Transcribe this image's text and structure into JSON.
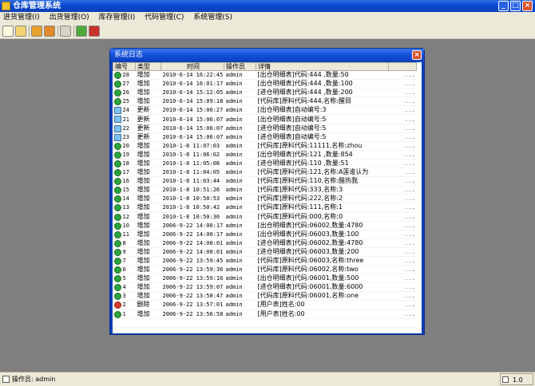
{
  "window": {
    "title": "仓库管理系统",
    "minimize": "_",
    "maximize": "□",
    "close": "×"
  },
  "menu": [
    "进货管理(I)",
    "出货管理(O)",
    "库存管理(I)",
    "代码管理(C)",
    "系统管理(S)"
  ],
  "dialog": {
    "title": "系统日志",
    "close": "×",
    "columns": [
      "编号",
      "类型",
      "时间",
      "操作员",
      "详情"
    ],
    "rows": [
      {
        "icon": "check-icon",
        "id": "28",
        "type": "增加",
        "time": "2010-6-14 16:22:45",
        "op": "admin",
        "detail": "[出仓明细表]代码:444 ,数量:50"
      },
      {
        "icon": "check-icon",
        "id": "27",
        "type": "增加",
        "time": "2010-6-14 16:01:17",
        "op": "admin",
        "detail": "[出仓明细表]代码:444 ,数量:100"
      },
      {
        "icon": "check-icon",
        "id": "26",
        "type": "增加",
        "time": "2010-6-14 15:12:05",
        "op": "admin",
        "detail": "[进仓明细表]代码:444 ,数量:200"
      },
      {
        "icon": "check-icon",
        "id": "25",
        "type": "增加",
        "time": "2010-6-14 15:09:18",
        "op": "admin",
        "detail": "[代码库]原料代码:444,名称:醒目"
      },
      {
        "icon": "edit-icon",
        "id": "24",
        "type": "更新",
        "time": "2010-6-14 15:06:27",
        "op": "admin",
        "detail": "[出仓明细表]自动编号:3"
      },
      {
        "icon": "edit-icon",
        "id": "21",
        "type": "更新",
        "time": "2010-6-14 15:06:07",
        "op": "admin",
        "detail": "[出仓明细表]自动编号:5"
      },
      {
        "icon": "edit-icon",
        "id": "22",
        "type": "更新",
        "time": "2010-6-14 15:06:07",
        "op": "admin",
        "detail": "[进仓明细表]自动编号:5"
      },
      {
        "icon": "edit-icon",
        "id": "23",
        "type": "更新",
        "time": "2010-6-14 15:06:07",
        "op": "admin",
        "detail": "[进仓明细表]自动编号:5"
      },
      {
        "icon": "check-icon",
        "id": "20",
        "type": "增加",
        "time": "2010-1-8 11:07:03",
        "op": "admin",
        "detail": "[代码库]原料代码:11111,名称:zhou"
      },
      {
        "icon": "check-icon",
        "id": "19",
        "type": "增加",
        "time": "2010-1-8 11:06:02",
        "op": "admin",
        "detail": "[出仓明细表]代码:121 ,数量:854"
      },
      {
        "icon": "check-icon",
        "id": "18",
        "type": "增加",
        "time": "2010-1-8 11:05:08",
        "op": "admin",
        "detail": "[进仓明细表]代码:110 ,数量:51"
      },
      {
        "icon": "check-icon",
        "id": "17",
        "type": "增加",
        "time": "2010-1-8 11:04:05",
        "op": "admin",
        "detail": "[代码库]原料代码:121,名称:A莲谁认为"
      },
      {
        "icon": "check-icon",
        "id": "16",
        "type": "增加",
        "time": "2010-1-8 11:03:44",
        "op": "admin",
        "detail": "[代码库]原料代码:110,名称:醋热我"
      },
      {
        "icon": "check-icon",
        "id": "15",
        "type": "增加",
        "time": "2010-1-8 10:51:26",
        "op": "admin",
        "detail": "[代码库]原料代码:333,名称:3"
      },
      {
        "icon": "check-icon",
        "id": "14",
        "type": "增加",
        "time": "2010-1-8 10:50:53",
        "op": "admin",
        "detail": "[代码库]原料代码:222,名称:2"
      },
      {
        "icon": "check-icon",
        "id": "13",
        "type": "增加",
        "time": "2010-1-8 10:50:42",
        "op": "admin",
        "detail": "[代码库]原料代码:111,名称:1"
      },
      {
        "icon": "check-icon",
        "id": "12",
        "type": "增加",
        "time": "2010-1-8 10:50:30",
        "op": "admin",
        "detail": "[代码库]原料代码:000,名称:0"
      },
      {
        "icon": "check-icon",
        "id": "10",
        "type": "增加",
        "time": "2006-9-22 14:00:17",
        "op": "admin",
        "detail": "[出仓明细表]代码:06002,数量:4780"
      },
      {
        "icon": "check-icon",
        "id": "11",
        "type": "增加",
        "time": "2006-9-22 14:00:17",
        "op": "admin",
        "detail": "[出仓明细表]代码:06003,数量:100"
      },
      {
        "icon": "check-icon",
        "id": "8",
        "type": "增加",
        "time": "2006-9-22 14:00:01",
        "op": "admin",
        "detail": "[进仓明细表]代码:06002,数量:4780"
      },
      {
        "icon": "check-icon",
        "id": "9",
        "type": "增加",
        "time": "2006-9-22 14:00:01",
        "op": "admin",
        "detail": "[进仓明细表]代码:06003,数量:200"
      },
      {
        "icon": "check-icon",
        "id": "7",
        "type": "增加",
        "time": "2006-9-22 13:59:45",
        "op": "admin",
        "detail": "[代码库]原料代码:06003,名称:three"
      },
      {
        "icon": "check-icon",
        "id": "6",
        "type": "增加",
        "time": "2006-9-22 13:59:36",
        "op": "admin",
        "detail": "[代码库]原料代码:06002,名称:two"
      },
      {
        "icon": "check-icon",
        "id": "5",
        "type": "增加",
        "time": "2006-9-22 13:59:16",
        "op": "admin",
        "detail": "[出仓明细表]代码:06001,数量:500"
      },
      {
        "icon": "check-icon",
        "id": "4",
        "type": "增加",
        "time": "2006-9-22 13:59:07",
        "op": "admin",
        "detail": "[进仓明细表]代码:06001,数量:6000"
      },
      {
        "icon": "check-icon",
        "id": "3",
        "type": "增加",
        "time": "2006-9-22 13:58:47",
        "op": "admin",
        "detail": "[代码库]原料代码:06001,名称:one"
      },
      {
        "icon": "delete-icon",
        "id": "2",
        "type": "删除",
        "time": "2006-9-22 13:57:01",
        "op": "admin",
        "detail": "[用户表]姓名:00"
      },
      {
        "icon": "check-icon",
        "id": "1",
        "type": "增加",
        "time": "2006-9-22 13:56:58",
        "op": "admin",
        "detail": "[用户表]姓名:00"
      }
    ],
    "more": "..."
  },
  "toolbar": [
    "new-icon",
    "open-icon",
    "edit-icon",
    "settings-icon",
    "search-icon",
    "refresh-icon",
    "exit-icon"
  ],
  "status": {
    "operator": "操作员: admin",
    "version": "1.0"
  },
  "colors": {
    "titlebar": "#0b4bd6",
    "workspace": "#7f7f7f",
    "chrome": "#ece9d8"
  }
}
